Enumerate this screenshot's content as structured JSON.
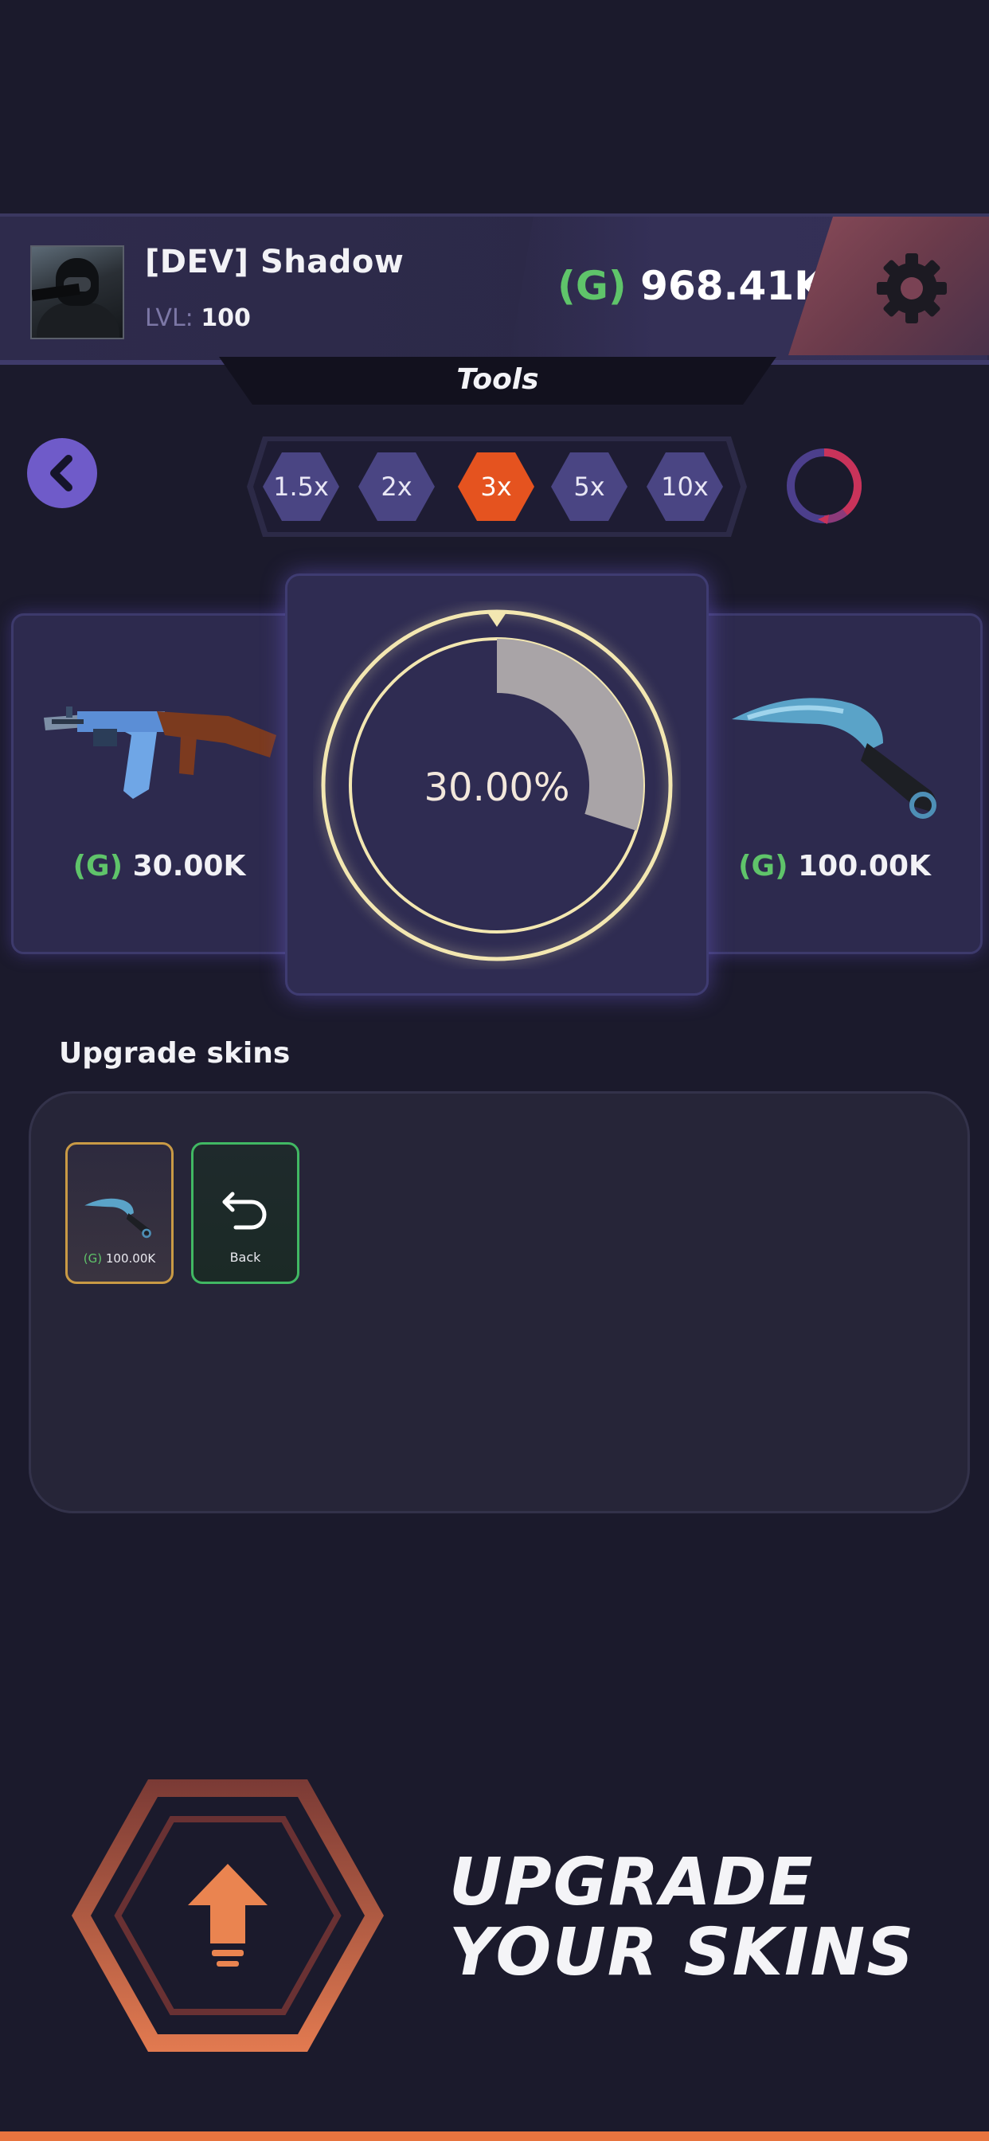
{
  "header": {
    "player_name": "[DEV] Shadow",
    "level_label": "LVL:",
    "level_value": "100",
    "currency_symbol": "(G)",
    "balance": "968.41K",
    "settings_icon": "gear-icon"
  },
  "tab": {
    "title": "Tools"
  },
  "multipliers": {
    "options": [
      "1.5x",
      "2x",
      "3x",
      "5x",
      "10x"
    ],
    "selected": "3x"
  },
  "upgrade": {
    "source_item": {
      "price": "30.00K",
      "icon": "rifle-icon"
    },
    "target_item": {
      "price": "100.00K",
      "icon": "knife-icon"
    },
    "chance_label": "30.00%",
    "chance_value": 0.3
  },
  "skins_section": {
    "title": "Upgrade skins",
    "items": [
      {
        "price": "100.00K",
        "icon": "knife-icon"
      }
    ],
    "back_label": "Back"
  },
  "cta": {
    "line1": "UPGRADE",
    "line2": "YOUR SKINS"
  },
  "colors": {
    "background": "#1b1a2c",
    "accent_orange": "#e5531f",
    "currency_green": "#5fc46a",
    "ring_gold": "#f3e7b1"
  }
}
